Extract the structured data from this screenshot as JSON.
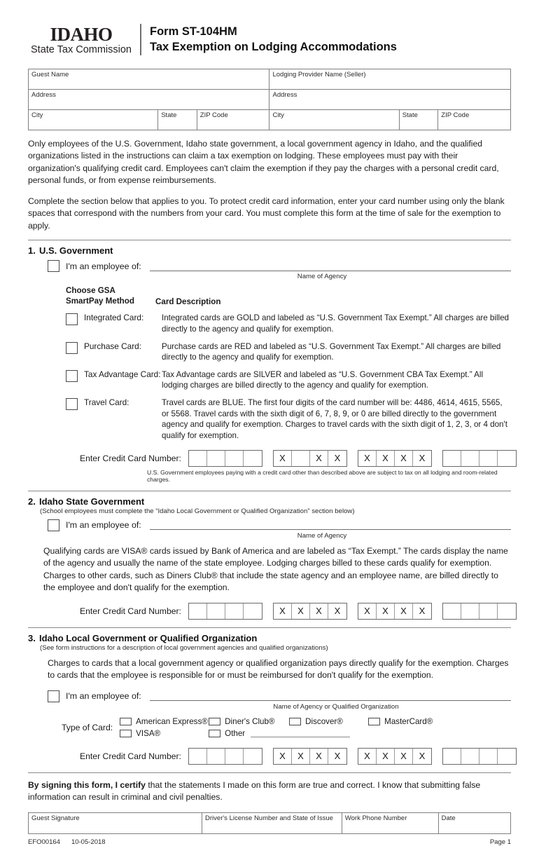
{
  "header": {
    "logo_state": "IDAHO",
    "logo_agency": "State Tax Commission",
    "form_number": "Form ST-104HM",
    "form_title": "Tax Exemption on Lodging Accommodations"
  },
  "address_table": {
    "guest_name": "Guest Name",
    "seller_name": "Lodging Provider Name (Seller)",
    "guest_address": "Address",
    "seller_address": "Address",
    "guest_city": "City",
    "guest_state": "State",
    "guest_zip": "ZIP Code",
    "seller_city": "City",
    "seller_state": "State",
    "seller_zip": "ZIP Code"
  },
  "intro": {
    "paragraph1": "Only employees of the U.S. Government, Idaho state government, a local government agency in Idaho, and the qualified organizations listed in the instructions can claim a tax exemption on lodging.  These employees must pay with their organization's qualifying credit card.  Employees can't claim the exemption if they pay the charges with a personal credit card, personal funds, or from expense reimbursements.",
    "paragraph2": "Complete the section below that applies to you.  To protect credit card information, enter your card number using only the blank spaces that correspond with the numbers from your card.  You must complete this form at the time of sale for the exemption to apply."
  },
  "section1": {
    "number": "1.",
    "title": "U.S. Government",
    "employee_label": "I'm an employee of:",
    "agency_caption": "Name of Agency",
    "gsa_header": "Choose GSA\nSmartPay Method",
    "gsa_header_line1": "Choose GSA",
    "gsa_header_line2": "SmartPay Method",
    "card_description_header": "Card Description",
    "cards": [
      {
        "name": "Integrated Card:",
        "description": "Integrated cards are GOLD and labeled as “U.S. Government Tax Exempt.”  All charges are billed directly to the agency and qualify for exemption."
      },
      {
        "name": "Purchase Card:",
        "description": "Purchase cards are RED and labeled as “U.S. Government Tax Exempt.”  All charges are billed directly to the agency and qualify for exemption."
      },
      {
        "name": "Tax Advantage Card:",
        "description": "Tax Advantage cards are SILVER and labeled as “U.S. Government CBA Tax Exempt.” All lodging charges are billed directly to the agency and qualify for exemption."
      },
      {
        "name": "Travel Card:",
        "description": "Travel cards are BLUE.  The first four digits of the card number will be: 4486, 4614, 4615, 5565, or 5568.  Travel cards with the sixth digit of 6, 7, 8, 9, or 0 are billed directly to the government agency and qualify for exemption.  Charges to travel cards with the sixth digit of 1, 2, 3, or 4 don't qualify for exemption."
      }
    ],
    "ccn_label": "Enter Credit Card Number:",
    "ccn_groups": [
      [
        "",
        "",
        "",
        ""
      ],
      [
        "X",
        "",
        "X",
        "X"
      ],
      [
        "X",
        "X",
        "X",
        "X"
      ],
      [
        "",
        "",
        "",
        ""
      ]
    ],
    "fineprint": "U.S. Government employees paying with a credit card other than described above are subject to tax on all lodging and room-related charges."
  },
  "section2": {
    "number": "2.",
    "title": "Idaho State Government",
    "note": "(School employees must complete the “Idaho Local Government or Qualified Organization” section below)",
    "employee_label": "I'm an employee of:",
    "agency_caption": "Name of Agency",
    "paragraph": "Qualifying cards are VISA® cards issued by Bank of America and are labeled as “Tax Exempt.”  The cards display the name of the agency and usually the name of the state employee.  Lodging charges billed to these cards qualify for exemption.  Charges to other cards, such as Diners Club® that include the state agency and an employee name, are billed directly to the employee and don't qualify for the exemption.",
    "ccn_label": "Enter Credit Card Number:",
    "ccn_groups": [
      [
        "",
        "",
        "",
        ""
      ],
      [
        "X",
        "X",
        "X",
        "X"
      ],
      [
        "X",
        "X",
        "X",
        "X"
      ],
      [
        "",
        "",
        "",
        ""
      ]
    ]
  },
  "section3": {
    "number": "3.",
    "title": "Idaho Local Government or Qualified Organization",
    "note": "(See form instructions for a description of local government agencies and qualified organizations)",
    "paragraph": "Charges to cards that a local government agency or qualified organization pays directly qualify for the exemption.  Charges to cards that the employee is responsible for or must be reimbursed for don't qualify for the exemption.",
    "employee_label": "I'm an employee of:",
    "agency_caption": "Name of Agency or Qualified Organization",
    "type_of_card_label": "Type of Card:",
    "card_types_row1": [
      "American Express®",
      "Diner's Club®",
      "Discover®",
      "MasterCard®"
    ],
    "card_types_row2": [
      "VISA®",
      "Other"
    ],
    "ccn_label": "Enter Credit Card Number:",
    "ccn_groups": [
      [
        "",
        "",
        "",
        ""
      ],
      [
        "X",
        "X",
        "X",
        "X"
      ],
      [
        "X",
        "X",
        "X",
        "X"
      ],
      [
        "",
        "",
        "",
        ""
      ]
    ]
  },
  "certify": {
    "bold_lead": "By signing this form, I certify",
    "rest": " that the statements I made on this form are true and correct.  I know that submitting false information can result in criminal and civil penalties."
  },
  "signature_table": {
    "guest_signature": "Guest Signature",
    "drivers_license": "Driver's License Number and State of Issue",
    "work_phone": "Work Phone Number",
    "date": "Date"
  },
  "footer": {
    "form_code": "EFO00164",
    "revision_date": "10-05-2018",
    "page": "Page 1"
  }
}
